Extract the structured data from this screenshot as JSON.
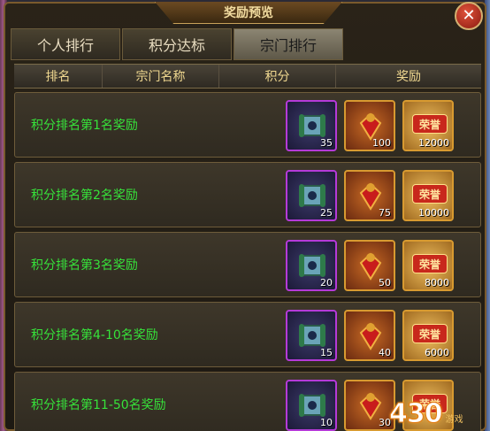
{
  "window": {
    "title": "奖励预览",
    "close_symbol": "✕"
  },
  "tabs": [
    {
      "label": "个人排行",
      "active": false
    },
    {
      "label": "积分达标",
      "active": false
    },
    {
      "label": "宗门排行",
      "active": true
    }
  ],
  "columns": [
    "排名",
    "宗门名称",
    "积分",
    "奖励"
  ],
  "rows": [
    {
      "label": "积分排名第1名奖励",
      "rewards": [
        {
          "icon": "scroll-icon",
          "qty": "35"
        },
        {
          "icon": "golden-fan-icon",
          "qty": "100"
        },
        {
          "icon": "honor-icon",
          "qty": "12000",
          "badge": "荣誉"
        }
      ]
    },
    {
      "label": "积分排名第2名奖励",
      "rewards": [
        {
          "icon": "scroll-icon",
          "qty": "25"
        },
        {
          "icon": "golden-fan-icon",
          "qty": "75"
        },
        {
          "icon": "honor-icon",
          "qty": "10000",
          "badge": "荣誉"
        }
      ]
    },
    {
      "label": "积分排名第3名奖励",
      "rewards": [
        {
          "icon": "scroll-icon",
          "qty": "20"
        },
        {
          "icon": "golden-fan-icon",
          "qty": "50"
        },
        {
          "icon": "honor-icon",
          "qty": "8000",
          "badge": "荣誉"
        }
      ]
    },
    {
      "label": "积分排名第4-10名奖励",
      "rewards": [
        {
          "icon": "scroll-icon",
          "qty": "15"
        },
        {
          "icon": "golden-fan-icon",
          "qty": "40"
        },
        {
          "icon": "honor-icon",
          "qty": "6000",
          "badge": "荣誉"
        }
      ]
    },
    {
      "label": "积分排名第11-50名奖励",
      "rewards": [
        {
          "icon": "scroll-icon",
          "qty": "10"
        },
        {
          "icon": "golden-fan-icon",
          "qty": "30"
        },
        {
          "icon": "honor-icon",
          "qty": "",
          "badge": "荣誉"
        }
      ]
    }
  ],
  "watermark": {
    "number": "430",
    "text": "游戏"
  },
  "colors": {
    "label_green": "#36e23a",
    "accent_gold": "#d89a30",
    "rare_purple": "#b53ad8"
  }
}
